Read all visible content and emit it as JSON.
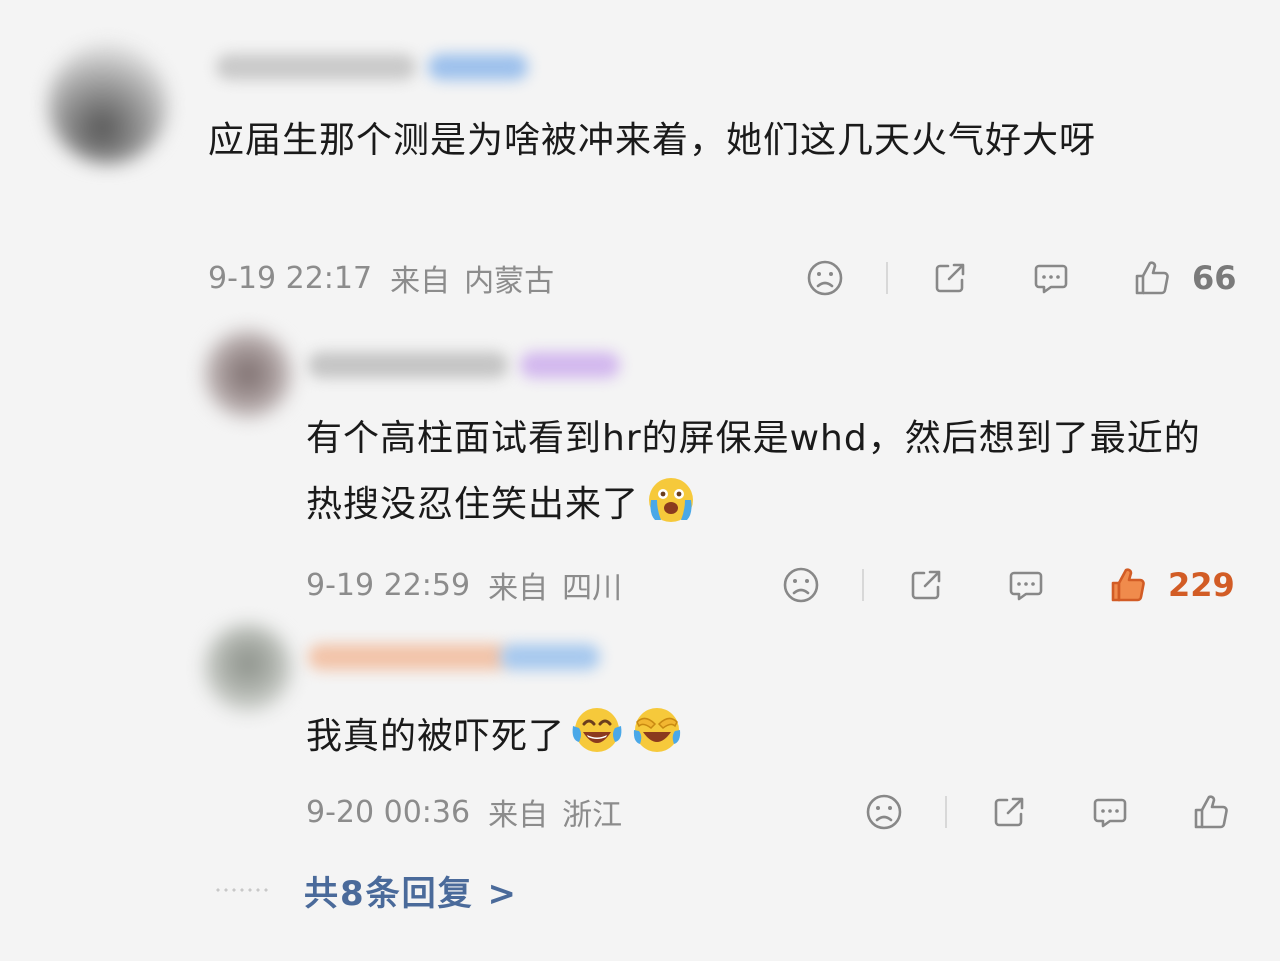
{
  "comments": [
    {
      "text": "应届生那个测是为啥被冲来着，她们这几天火气好大呀",
      "date": "9-19 22:17",
      "source": "来自",
      "location": "内蒙古",
      "likes": "66",
      "liked": false
    },
    {
      "text": "有个高柱面试看到hr的屏保是whd，然后想到了最近的热搜没忍住笑出来了",
      "emoji": [
        "crying-face"
      ],
      "date": "9-19 22:59",
      "source": "来自",
      "location": "四川",
      "likes": "229",
      "liked": true
    },
    {
      "text": "我真的被吓死了",
      "emoji": [
        "tears-of-joy-face",
        "covering-face-laughing"
      ],
      "date": "9-20 00:36",
      "source": "来自",
      "location": "浙江",
      "likes": "",
      "liked": false
    }
  ],
  "more_replies": "共8条回复 >",
  "colors": {
    "background": "#f4f4f4",
    "text": "#1a1a1a",
    "meta": "#8c8c8c",
    "like_active": "#e8703a",
    "link": "#4a6a9a"
  },
  "icons": [
    "sad-face-icon",
    "share-icon",
    "comment-icon",
    "thumbs-up-icon"
  ]
}
